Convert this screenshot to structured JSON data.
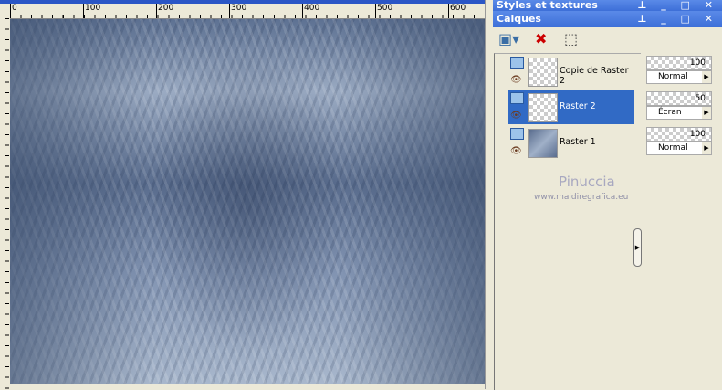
{
  "ruler": {
    "top_labels": [
      "0",
      "100",
      "200",
      "300",
      "400",
      "500",
      "600"
    ]
  },
  "panels": {
    "styles_title": "Styles et textures",
    "calques_title": "Calques",
    "title_buttons": "⊥ _ □ ✕"
  },
  "layers": [
    {
      "name": "Copie de Raster 2",
      "opacity": "100",
      "blend": "Normal",
      "selected": false
    },
    {
      "name": "Raster 2",
      "opacity": "50",
      "blend": "Écran",
      "selected": true
    },
    {
      "name": "Raster 1",
      "opacity": "100",
      "blend": "Normal",
      "selected": false
    }
  ],
  "watermark": {
    "name": "Pinuccia",
    "url": "www.maidiregrafica.eu"
  },
  "colors": {
    "selection": "#316ac5",
    "titlebar": "#3d6fd8"
  }
}
